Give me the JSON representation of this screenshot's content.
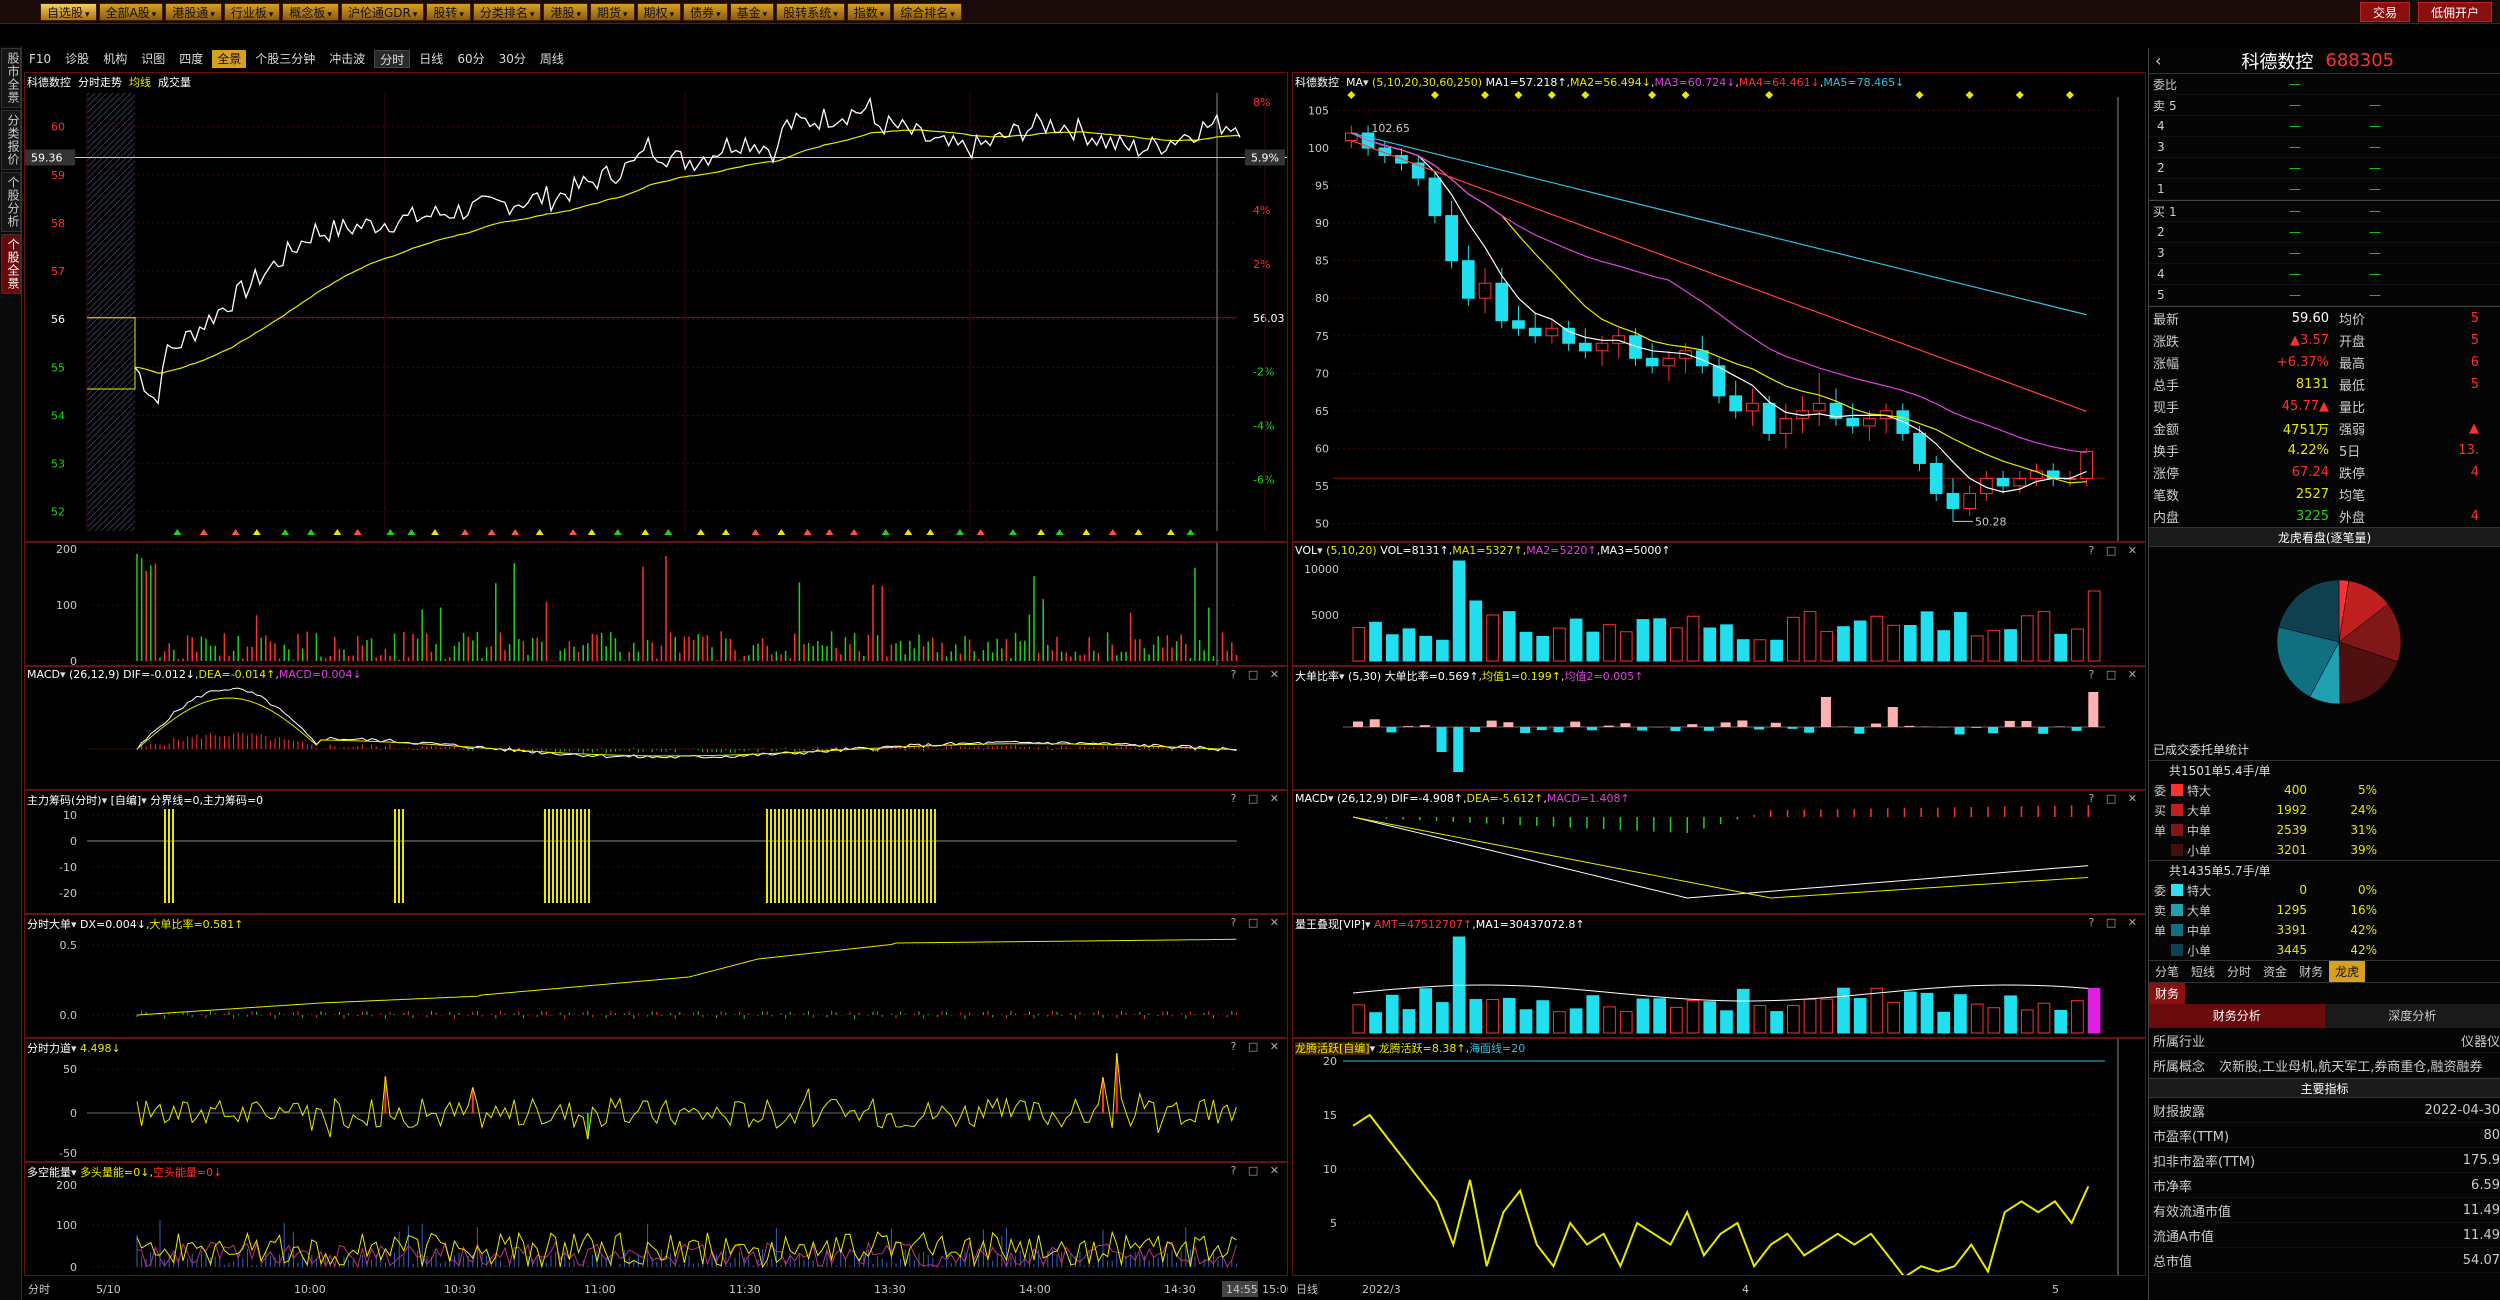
{
  "topbar": {
    "menus": [
      "自选股",
      "全部A股",
      "港股通",
      "行业板",
      "概念板",
      "沪伦通GDR",
      "股转",
      "分类排名",
      "港股",
      "期货",
      "期权",
      "债券",
      "基金",
      "股转系统",
      "指数",
      "综合排名"
    ],
    "right_buttons": [
      "交易",
      "低佣开户"
    ]
  },
  "left_tabs": [
    "股市全景",
    "分类报价",
    "个股分析",
    "个股全景"
  ],
  "toolbar2": {
    "items": [
      "F10",
      "诊股",
      "机构",
      "识图",
      "四度",
      "全景",
      "个股三分钟",
      "冲击波"
    ],
    "period_group": [
      "分时",
      "日线",
      "60分",
      "30分",
      "周线"
    ],
    "active": "全景"
  },
  "intraday": {
    "header": {
      "name": "科德数控",
      "mode": "分时走势",
      "avg": "均线",
      "vol": "成交量"
    },
    "price_labels": [
      "60",
      "59",
      "58",
      "57",
      "56",
      "55",
      "54",
      "53",
      "52"
    ],
    "pct_labels": [
      "8%",
      "6%",
      "4%",
      "2%",
      "",
      "-2%",
      "-4%",
      "-6%"
    ],
    "prev_close": "56.03",
    "current_left": "59.36",
    "current_right": "5.9%",
    "vol_labels": [
      "200",
      "100",
      "0"
    ],
    "time_labels": [
      "分时",
      "5/10",
      "10:00",
      "10:30",
      "11:00",
      "11:30",
      "13:30",
      "14:00",
      "14:30",
      "14:55",
      "15:00"
    ]
  },
  "ind_macd": {
    "title": "MACD",
    "params": "(26,12,9)",
    "dif": "DIF=-0.012↓",
    "dea": "DEA=-0.014↑",
    "macd": "MACD=0.004↓"
  },
  "ind_zlcm": {
    "title": "主力筹码(分时)",
    "mode": "[自编]",
    "desc": "分界线=0,主力筹码=0",
    "labels": [
      "10",
      "0",
      "-10",
      "-20"
    ]
  },
  "ind_fsdd": {
    "title": "分时大单",
    "dx": "DX=0.004↓",
    "ratio": "大单比率=0.581↑",
    "labels": [
      "0.5",
      "0.0"
    ]
  },
  "ind_fsld": {
    "title": "分时力道",
    "val": "4.498↓",
    "labels": [
      "50",
      "0",
      "-50"
    ]
  },
  "ind_dkzn": {
    "title": "多空能量",
    "bull": "多头量能=0↓",
    "bear": "空头能量=0↓",
    "labels": [
      "200",
      "100",
      "0"
    ]
  },
  "kline": {
    "header": {
      "name": "科德数控",
      "ma": "MA",
      "params": "(5,10,20,30,60,250)",
      "ma1": "MA1=57.218↑",
      "ma2": "MA2=56.494↓",
      "ma3": "MA3=60.724↓",
      "ma4": "MA4=64.461↓",
      "ma5": "MA5=78.465↓"
    },
    "price_labels": [
      "105",
      "100",
      "95",
      "90",
      "85",
      "80",
      "75",
      "70",
      "65",
      "60",
      "55",
      "50"
    ],
    "high_mark": "102.65",
    "low_mark": "50.28",
    "date_labels": [
      "日线",
      "2022/3",
      "4",
      "5"
    ],
    "candles": [
      [
        101,
        103,
        100,
        102
      ],
      [
        102,
        103,
        99,
        100
      ],
      [
        100,
        101,
        98,
        99
      ],
      [
        99,
        100,
        97,
        98
      ],
      [
        98,
        99,
        95,
        96
      ],
      [
        96,
        97,
        90,
        91
      ],
      [
        91,
        93,
        84,
        85
      ],
      [
        85,
        87,
        79,
        80
      ],
      [
        80,
        84,
        78,
        82
      ],
      [
        82,
        84,
        76,
        77
      ],
      [
        77,
        79,
        75,
        76
      ],
      [
        76,
        78,
        74,
        75
      ],
      [
        75,
        77,
        74,
        76
      ],
      [
        76,
        77,
        73,
        74
      ],
      [
        74,
        76,
        72,
        73
      ],
      [
        73,
        75,
        71,
        74
      ],
      [
        74,
        76,
        72,
        75
      ],
      [
        75,
        76,
        71,
        72
      ],
      [
        72,
        74,
        70,
        71
      ],
      [
        71,
        73,
        69,
        72
      ],
      [
        72,
        74,
        70,
        73
      ],
      [
        73,
        75,
        70,
        71
      ],
      [
        71,
        72,
        66,
        67
      ],
      [
        67,
        69,
        64,
        65
      ],
      [
        65,
        68,
        63,
        66
      ],
      [
        66,
        67,
        61,
        62
      ],
      [
        62,
        66,
        60,
        64
      ],
      [
        64,
        67,
        62,
        65
      ],
      [
        65,
        70,
        63,
        66
      ],
      [
        66,
        68,
        63,
        64
      ],
      [
        64,
        66,
        62,
        63
      ],
      [
        63,
        65,
        61,
        64
      ],
      [
        64,
        66,
        62,
        65
      ],
      [
        65,
        66,
        61,
        62
      ],
      [
        62,
        63,
        57,
        58
      ],
      [
        58,
        59,
        53,
        54
      ],
      [
        54,
        56,
        50.3,
        52
      ],
      [
        52,
        55,
        51,
        54
      ],
      [
        54,
        57,
        53,
        56
      ],
      [
        56,
        57,
        54,
        55
      ],
      [
        55,
        57,
        54,
        56
      ],
      [
        56,
        58,
        55,
        57
      ],
      [
        57,
        58,
        55,
        56
      ],
      [
        56,
        57,
        55,
        56
      ],
      [
        56,
        60,
        55,
        59.6
      ]
    ],
    "vol_header": {
      "title": "VOL",
      "params": "(5,10,20)",
      "vol": "VOL=8131↑",
      "ma1": "MA1=5327↑",
      "ma2": "MA2=5220↑",
      "ma3": "MA3=5000↑"
    },
    "vol_labels": [
      "10000",
      "5000"
    ],
    "ddbl_header": {
      "title": "大单比率",
      "params": "(5,30)",
      "val": "大单比率=0.569↑",
      "avg1": "均值1=0.199↑",
      "avg2": "均值2=0.005↑"
    },
    "macd_header": {
      "title": "MACD",
      "params": "(26,12,9)",
      "dif": "DIF=-4.908↑",
      "dea": "DEA=-5.612↑",
      "macd": "MACD=1.408↑"
    },
    "lwdx_header": {
      "title": "量王叠现[VIP]",
      "amt": "AMT=47512707↑",
      "ma1": "MA1=30437072.8↑"
    },
    "lthy_header": {
      "title": "龙腾活跃[自编]",
      "val": "龙腾活跃=8.38↑",
      "sea": "海面线=20"
    },
    "lthy_labels": [
      "20",
      "15",
      "10",
      "5"
    ]
  },
  "info": {
    "stock_name": "科德数控",
    "stock_code": "688305",
    "order_book": {
      "ask_label": "委比",
      "asks": [
        [
          "卖",
          "5",
          "—"
        ],
        [
          "",
          "4",
          "—"
        ],
        [
          "",
          "3",
          "—"
        ],
        [
          "",
          "2",
          "—"
        ],
        [
          "",
          "1",
          "—"
        ]
      ],
      "bids": [
        [
          "买",
          "1",
          "—"
        ],
        [
          "",
          "2",
          "—"
        ],
        [
          "",
          "3",
          "—"
        ],
        [
          "",
          "4",
          "—"
        ],
        [
          "",
          "5",
          "—"
        ]
      ]
    },
    "quotes": [
      [
        "最新",
        "59.60",
        "均价",
        "5"
      ],
      [
        "涨跌",
        "▲3.57",
        "开盘",
        "5"
      ],
      [
        "涨幅",
        "+6.37%",
        "最高",
        "6"
      ],
      [
        "总手",
        "8131",
        "最低",
        "5"
      ],
      [
        "现手",
        "45.77▲",
        "量比",
        ""
      ],
      [
        "金额",
        "4751万",
        "强弱",
        "▲"
      ],
      [
        "换手",
        "4.22%",
        "5日",
        "13."
      ],
      [
        "涨停",
        "67.24",
        "跌停",
        "4"
      ],
      [
        "笔数",
        "2527",
        "均笔",
        ""
      ],
      [
        "内盘",
        "3225",
        "外盘",
        "4"
      ]
    ],
    "lhkp_title": "龙虎看盘(逐笔量)",
    "entrust_title": "已成交委托单统计",
    "buy_summary": "共1501单5.4手/单",
    "buy_stats": [
      [
        "委",
        "特大",
        "400",
        "5%"
      ],
      [
        "买",
        "大单",
        "1992",
        "24%"
      ],
      [
        "单",
        "中单",
        "2539",
        "31%"
      ],
      [
        "",
        "小单",
        "3201",
        "39%"
      ]
    ],
    "sell_summary": "共1435单5.7手/单",
    "sell_stats": [
      [
        "委",
        "特大",
        "0",
        "0%"
      ],
      [
        "卖",
        "大单",
        "1295",
        "16%"
      ],
      [
        "单",
        "中单",
        "3391",
        "42%"
      ],
      [
        "",
        "小单",
        "3445",
        "42%"
      ]
    ],
    "bottom_tabs": [
      "分笔",
      "短线",
      "分时",
      "资金",
      "财务",
      "龙虎"
    ],
    "fin_tab": "财务",
    "fin_subtabs": [
      "财务分析",
      "深度分析"
    ],
    "industry_label": "所属行业",
    "industry_value": "仪器仪",
    "concept_label": "所属概念",
    "concept_value": "次新股,工业母机,航天军工,券商重仓,融资融券",
    "main_index_title": "主要指标",
    "fin_rows": [
      [
        "财报披露",
        "2022-04-30"
      ],
      [
        "市盈率(TTM)",
        "80"
      ],
      [
        "扣非市盈率(TTM)",
        "175.9"
      ],
      [
        "市净率",
        "6.59"
      ],
      [
        "有效流通市值",
        "11.49"
      ],
      [
        "流通A市值",
        "11.49"
      ],
      [
        "总市值",
        "54.07"
      ]
    ]
  },
  "colors": {
    "up": "#ff3030",
    "down": "#20e0f0",
    "price_line": "#ffffff",
    "avg_line": "#e8e800",
    "panel_border": "#6a1010"
  }
}
